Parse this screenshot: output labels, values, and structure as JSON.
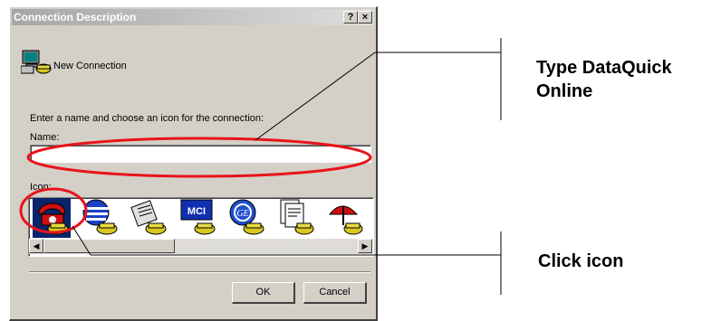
{
  "dialog": {
    "title": "Connection Description",
    "help_button": "?",
    "close_button": "×",
    "connection_name": "New Connection",
    "instructions": "Enter a name and choose an icon for the connection:",
    "name_label": "Name:",
    "name_value": "",
    "icon_label": "Icon:",
    "icons": [
      "red-phone-icon",
      "globe-phone-icon",
      "fax-phone-icon",
      "mci-phone-icon",
      "ge-phone-icon",
      "document-phone-icon",
      "umbrella-phone-icon"
    ],
    "ok_button": "OK",
    "cancel_button": "Cancel"
  },
  "annotations": {
    "callout_top_line1": "Type DataQuick",
    "callout_top_line2": "Online",
    "callout_bottom": "Click icon",
    "highlight_color": "#e8131b"
  }
}
